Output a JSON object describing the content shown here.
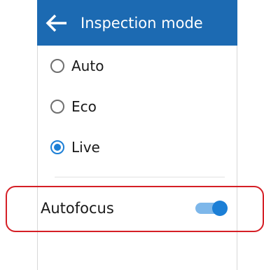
{
  "header": {
    "title": "Inspection mode",
    "back_icon": "arrow-left-icon",
    "color": "#1c6ab2"
  },
  "inspection_modes": [
    {
      "label": "Auto",
      "selected": false
    },
    {
      "label": "Eco",
      "selected": false
    },
    {
      "label": "Live",
      "selected": true
    }
  ],
  "autofocus": {
    "label": "Autofocus",
    "enabled": true
  },
  "colors": {
    "accent": "#1c7fd6",
    "highlight_border": "#d51f26"
  }
}
